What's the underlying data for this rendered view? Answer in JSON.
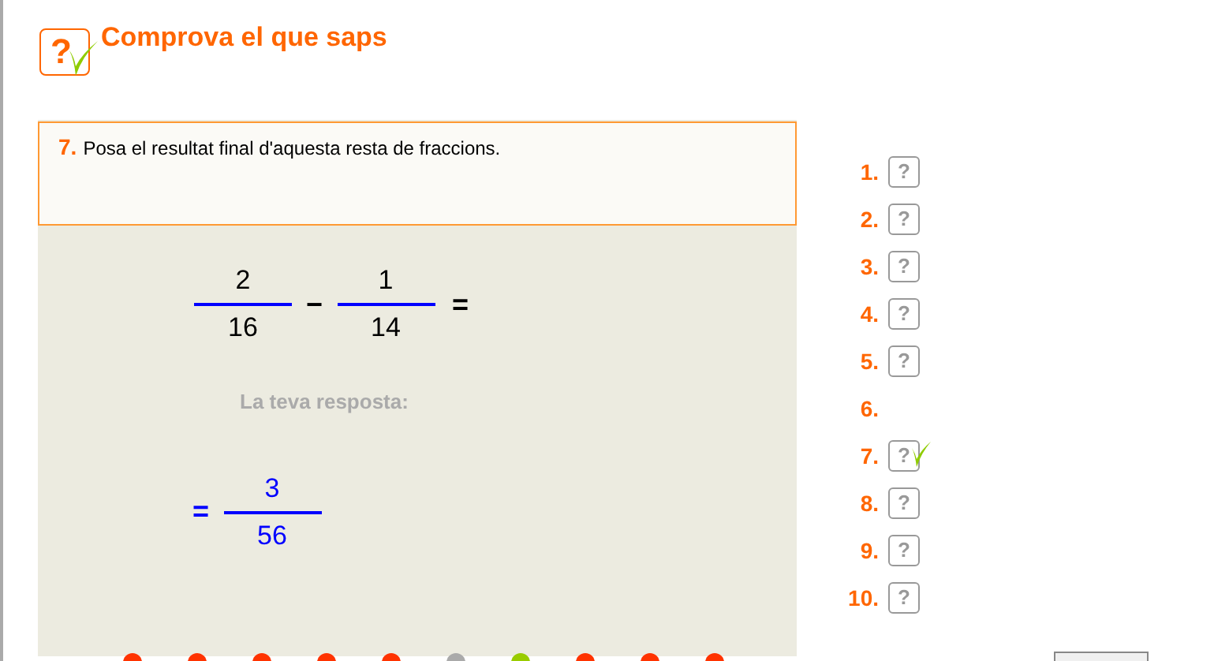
{
  "header": {
    "logo_mark": "?",
    "title": "Comprova el que saps"
  },
  "question": {
    "number": "7.",
    "text": "Posa el resultat final d'aquesta resta de fraccions."
  },
  "expression": {
    "fraction_1": {
      "numerator": "2",
      "denominator": "16"
    },
    "operator": "−",
    "fraction_2": {
      "numerator": "1",
      "denominator": "14"
    },
    "equals": "="
  },
  "answer_label": "La teva resposta:",
  "answer": {
    "equals": "=",
    "numerator": "3",
    "denominator": "56"
  },
  "question_list": [
    {
      "number": "1.",
      "icon": "?",
      "correct": false
    },
    {
      "number": "2.",
      "icon": "?",
      "correct": false
    },
    {
      "number": "3.",
      "icon": "?",
      "correct": false
    },
    {
      "number": "4.",
      "icon": "?",
      "correct": false
    },
    {
      "number": "5.",
      "icon": "?",
      "correct": false
    },
    {
      "number": "6.",
      "correct": false
    },
    {
      "number": "7.",
      "icon": "?",
      "correct": true
    },
    {
      "number": "8.",
      "icon": "?",
      "correct": false
    },
    {
      "number": "9.",
      "icon": "?",
      "correct": false
    },
    {
      "number": "10.",
      "icon": "?",
      "correct": false
    }
  ],
  "progress_dots": [
    {
      "color": "#ff3300"
    },
    {
      "color": "#ff3300"
    },
    {
      "color": "#ff3300"
    },
    {
      "color": "#ff3300"
    },
    {
      "color": "#ff3300"
    },
    {
      "color": "#aaaaaa"
    },
    {
      "color": "#99cc00"
    },
    {
      "color": "#ff3300"
    },
    {
      "color": "#ff3300"
    },
    {
      "color": "#ff3300"
    }
  ]
}
